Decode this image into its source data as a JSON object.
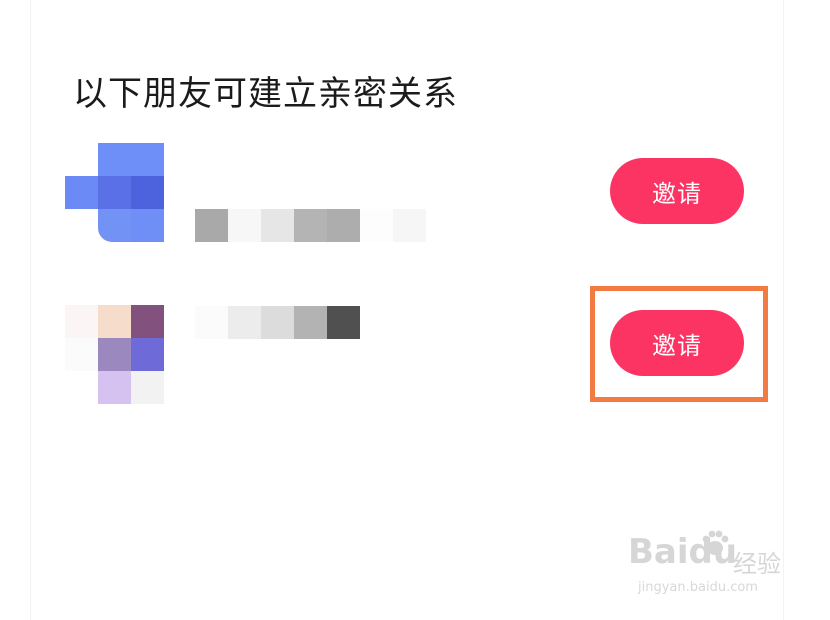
{
  "header": {
    "title": "以下朋友可建立亲密关系"
  },
  "friends": [
    {
      "invite_label": "邀请"
    },
    {
      "invite_label": "邀请"
    }
  ],
  "watermark": {
    "brand": "Bai",
    "brand_suffix": "du",
    "product": "经验",
    "url": "jingyan.baidu.com"
  },
  "colors": {
    "invite_button": "#fc3463",
    "highlight": "#f27a43"
  }
}
